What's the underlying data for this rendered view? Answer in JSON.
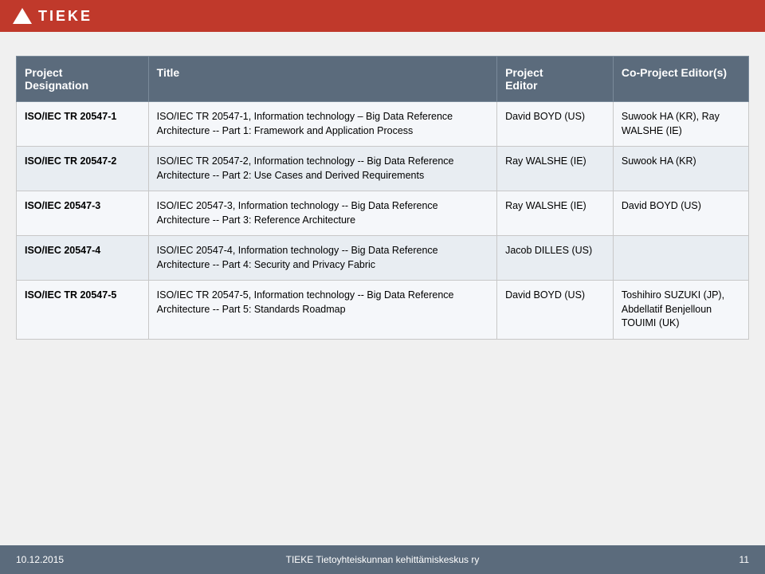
{
  "header": {
    "logo_triangle": "▲",
    "title": "TIEKE"
  },
  "table": {
    "columns": [
      {
        "id": "designation",
        "label": "Project\nDesignation"
      },
      {
        "id": "title",
        "label": "Title"
      },
      {
        "id": "editor",
        "label": "Project\nEditor"
      },
      {
        "id": "co_editor",
        "label": "Co-Project\nEditor(s)"
      }
    ],
    "rows": [
      {
        "designation": "ISO/IEC TR 20547-1",
        "title": "ISO/IEC TR 20547-1, Information technology – Big Data Reference Architecture -- Part 1: Framework and Application Process",
        "editor": "David BOYD (US)",
        "co_editor": "Suwook HA (KR), Ray WALSHE (IE)"
      },
      {
        "designation": "ISO/IEC TR 20547-2",
        "title": "ISO/IEC TR 20547-2, Information technology -- Big Data Reference Architecture -- Part 2: Use Cases and Derived Requirements",
        "editor": "Ray WALSHE (IE)",
        "co_editor": "Suwook HA (KR)"
      },
      {
        "designation": "ISO/IEC 20547-3",
        "title": "ISO/IEC 20547-3, Information technology -- Big Data Reference Architecture -- Part 3: Reference Architecture",
        "editor": "Ray WALSHE (IE)",
        "co_editor": "David BOYD (US)"
      },
      {
        "designation": "ISO/IEC 20547-4",
        "title": "ISO/IEC 20547-4, Information technology -- Big Data Reference Architecture -- Part 4: Security and Privacy Fabric",
        "editor": "Jacob DILLES (US)",
        "co_editor": ""
      },
      {
        "designation": "ISO/IEC TR 20547-5",
        "title": "ISO/IEC TR 20547-5, Information technology -- Big Data Reference Architecture -- Part 5: Standards Roadmap",
        "editor": "David BOYD (US)",
        "co_editor": "Toshihiro SUZUKI (JP), Abdellatif Benjelloun TOUIMI (UK)"
      }
    ]
  },
  "footer": {
    "date": "10.12.2015",
    "center_text": "TIEKE Tietoyhteiskunnan kehittämiskeskus ry",
    "page": "11"
  }
}
